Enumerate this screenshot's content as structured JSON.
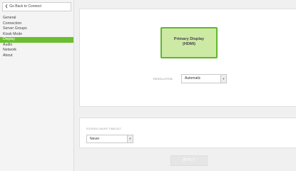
{
  "sidebar": {
    "back_label": "Go Back to Connect",
    "items": [
      {
        "label": "General"
      },
      {
        "label": "Connection"
      },
      {
        "label": "Server Groups"
      },
      {
        "label": "Kiosk Mode"
      },
      {
        "label": "Display",
        "active": true
      },
      {
        "label": "Audio"
      },
      {
        "label": "Network"
      },
      {
        "label": "About"
      }
    ]
  },
  "display": {
    "name": "Primary Display",
    "connector": "(HDMI)",
    "resolution_label": "RESOLUTION",
    "resolution_value": "Automatic"
  },
  "screensaver": {
    "label": "SCREEN SAVER TIMEOUT",
    "value": "Never"
  },
  "apply_label": "APPLY",
  "colors": {
    "accent": "#6abf2e",
    "display_fill": "#cdeaa5",
    "display_border": "#62b72a"
  }
}
